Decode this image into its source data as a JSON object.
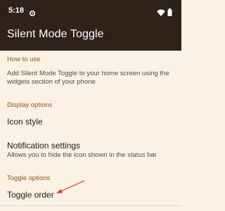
{
  "status_bar": {
    "time": "5:18",
    "icons": [
      "gear-icon",
      "wifi-icon",
      "battery-icon"
    ]
  },
  "app_bar": {
    "title": "Silent Mode Toggle"
  },
  "sections": {
    "how_to_use": {
      "header": "How to use",
      "summary": "Add Silent Mode Toggle to your home screen using the widgets section of your phone"
    },
    "display_options": {
      "header": "Display options",
      "icon_style": {
        "title": "Icon style"
      },
      "notification_settings": {
        "title": "Notification settings",
        "summary": "Allows you to hide the icon shown in the status bar"
      }
    },
    "toggle_options": {
      "header": "Toggle options",
      "toggle_order": {
        "title": "Toggle order"
      }
    }
  },
  "colors": {
    "background": "#fbf1e4",
    "app_bar": "#2e2219",
    "section_header": "#8a5a1d",
    "annotation_arrow": "#e03131"
  }
}
